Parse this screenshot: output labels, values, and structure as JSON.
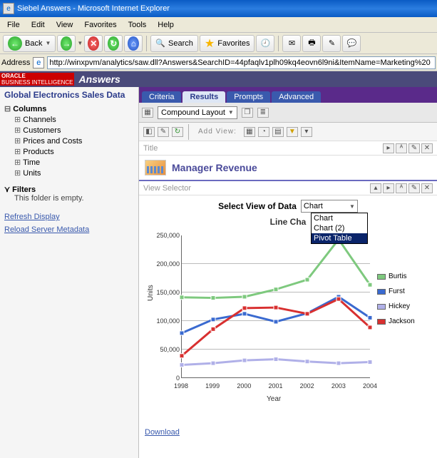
{
  "window": {
    "title": "Siebel Answers - Microsoft Internet Explorer"
  },
  "menubar": [
    "File",
    "Edit",
    "View",
    "Favorites",
    "Tools",
    "Help"
  ],
  "toolbar": {
    "back": "Back",
    "search": "Search",
    "favorites": "Favorites"
  },
  "address": {
    "label": "Address",
    "url": "http://winxpvm/analytics/saw.dll?Answers&SearchID=44pfaqlv1plh09kq4eovn6l9ni&ItemName=Marketing%20"
  },
  "app": {
    "brand_top": "ORACLE",
    "brand_bot": "BUSINESS INTELLIGENCE",
    "name": "Answers"
  },
  "sidebar": {
    "subject": "Global Electronics Sales Data",
    "columns_label": "Columns",
    "columns": [
      "Channels",
      "Customers",
      "Prices and Costs",
      "Products",
      "Time",
      "Units"
    ],
    "filters_label": "Filters",
    "filters_empty": "This folder is empty.",
    "refresh": "Refresh Display",
    "reload": "Reload Server Metadata"
  },
  "tabs": [
    "Criteria",
    "Results",
    "Prompts",
    "Advanced"
  ],
  "active_tab": "Results",
  "compound": {
    "label": "Compound Layout"
  },
  "addview": {
    "label": "Add View:"
  },
  "sections": {
    "title": "Title",
    "view_selector": "View Selector"
  },
  "report_title": "Manager Revenue",
  "view_select": {
    "label": "Select View of Data",
    "value": "Chart",
    "options": [
      "Chart",
      "Chart (2)",
      "Pivot Table"
    ],
    "selected_option": "Pivot Table"
  },
  "chart_title_partial": "Line Cha",
  "download": "Download",
  "chart_data": {
    "type": "line",
    "title": "Line Chart",
    "xlabel": "Year",
    "ylabel": "Units",
    "ylim": [
      0,
      250000
    ],
    "yticks": [
      0,
      50000,
      100000,
      150000,
      200000,
      250000
    ],
    "ytick_labels": [
      "0",
      "50,000",
      "100,000",
      "150,000",
      "200,000",
      "250,000"
    ],
    "x": [
      1998,
      1999,
      2000,
      2001,
      2002,
      2003,
      2004
    ],
    "series": [
      {
        "name": "Burtis",
        "color": "#7ec97e",
        "values": [
          141000,
          140000,
          142000,
          155000,
          172000,
          243000,
          163000
        ]
      },
      {
        "name": "Furst",
        "color": "#3a6ad0",
        "values": [
          78000,
          102000,
          112000,
          98000,
          113000,
          142000,
          105000
        ]
      },
      {
        "name": "Hickey",
        "color": "#b0b0e8",
        "values": [
          22000,
          25000,
          30000,
          32000,
          28000,
          25000,
          27000
        ]
      },
      {
        "name": "Jackson",
        "color": "#d83030",
        "values": [
          38000,
          85000,
          122000,
          123000,
          112000,
          138000,
          88000
        ]
      }
    ]
  }
}
